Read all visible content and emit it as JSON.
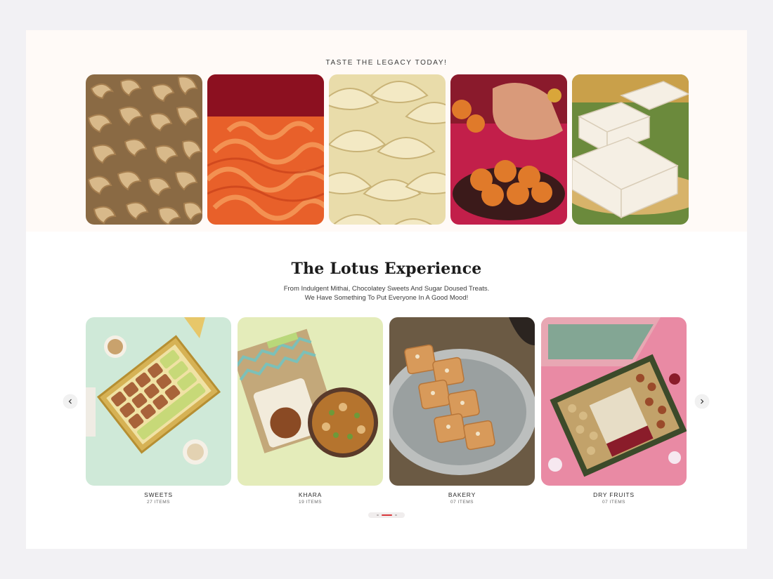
{
  "legacy": {
    "title": "TASTE THE LEGACY TODAY!",
    "images": [
      {
        "icon": "cashews-image"
      },
      {
        "icon": "jalebi-image"
      },
      {
        "icon": "gujiya-image"
      },
      {
        "icon": "laddoo-image"
      },
      {
        "icon": "barfi-image"
      }
    ]
  },
  "lotus": {
    "title": "The Lotus Experience",
    "subtitle_line1": "From Indulgent Mithai, Chocolatey Sweets And Sugar Doused Treats.",
    "subtitle_line2": "We Have Something To Put Everyone In A Good Mood!",
    "categories": [
      {
        "name": "SWEETS",
        "count": "27 ITEMS"
      },
      {
        "name": "KHARA",
        "count": "19 ITEMS"
      },
      {
        "name": "BAKERY",
        "count": "07 ITEMS"
      },
      {
        "name": "DRY FRUITS",
        "count": "07 ITEMS"
      }
    ],
    "prev_icon": "chevron-left-icon",
    "next_icon": "chevron-right-icon",
    "pagination": {
      "pages": 3,
      "active": 1
    }
  },
  "colors": {
    "page_bg": "#f2f1f4",
    "legacy_bg": "#fffaf7",
    "accent": "#d8363b"
  }
}
